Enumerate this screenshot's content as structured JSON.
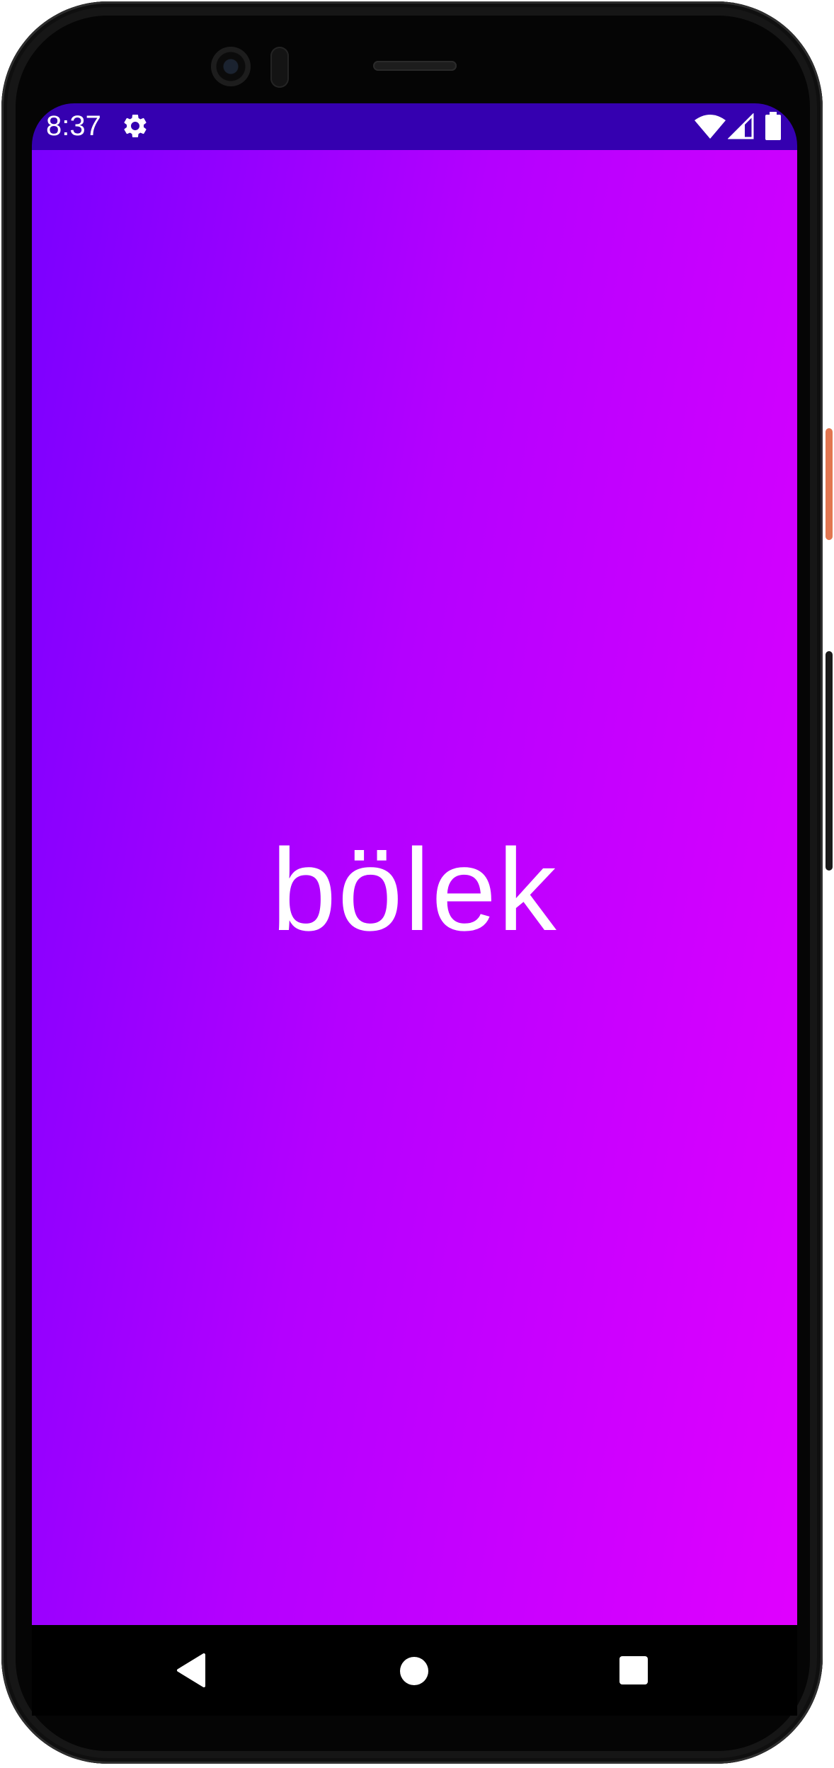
{
  "status_bar": {
    "time": "8:37",
    "icons": [
      "gear-icon",
      "wifi-icon",
      "signal-icon",
      "battery-icon"
    ],
    "background_color": "#3500b0"
  },
  "splash": {
    "logo_text": "bölek",
    "gradient_colors": [
      "#7a00ff",
      "#b400ff",
      "#e000ff"
    ],
    "text_color": "#ffffff"
  },
  "nav_bar": {
    "buttons": [
      "back",
      "home",
      "recents"
    ],
    "icons": [
      "nav-back-icon",
      "nav-home-icon",
      "nav-recents-icon"
    ]
  },
  "device": {
    "frame_color": "#161616",
    "power_button_color": "#e27650"
  }
}
